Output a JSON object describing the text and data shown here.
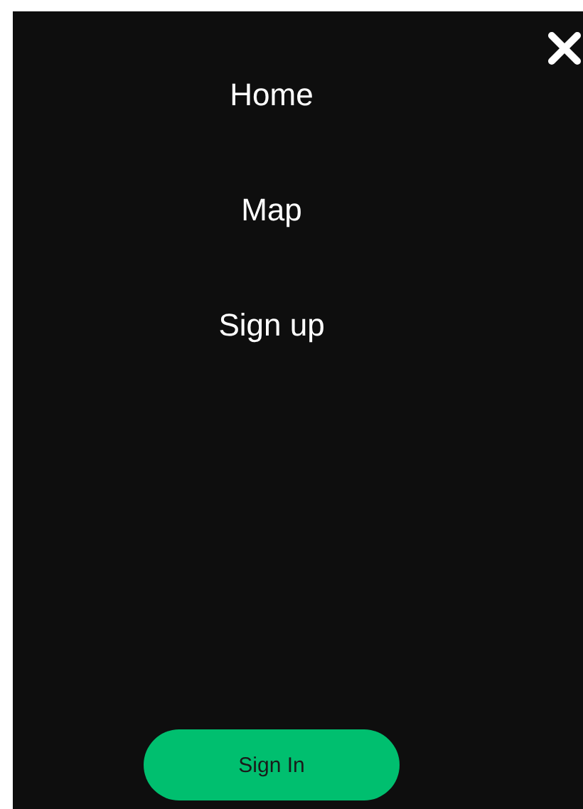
{
  "nav_items": [
    {
      "label": "Home"
    },
    {
      "label": "Map"
    },
    {
      "label": "Sign up"
    }
  ],
  "sign_in_button": {
    "label": "Sign In"
  }
}
